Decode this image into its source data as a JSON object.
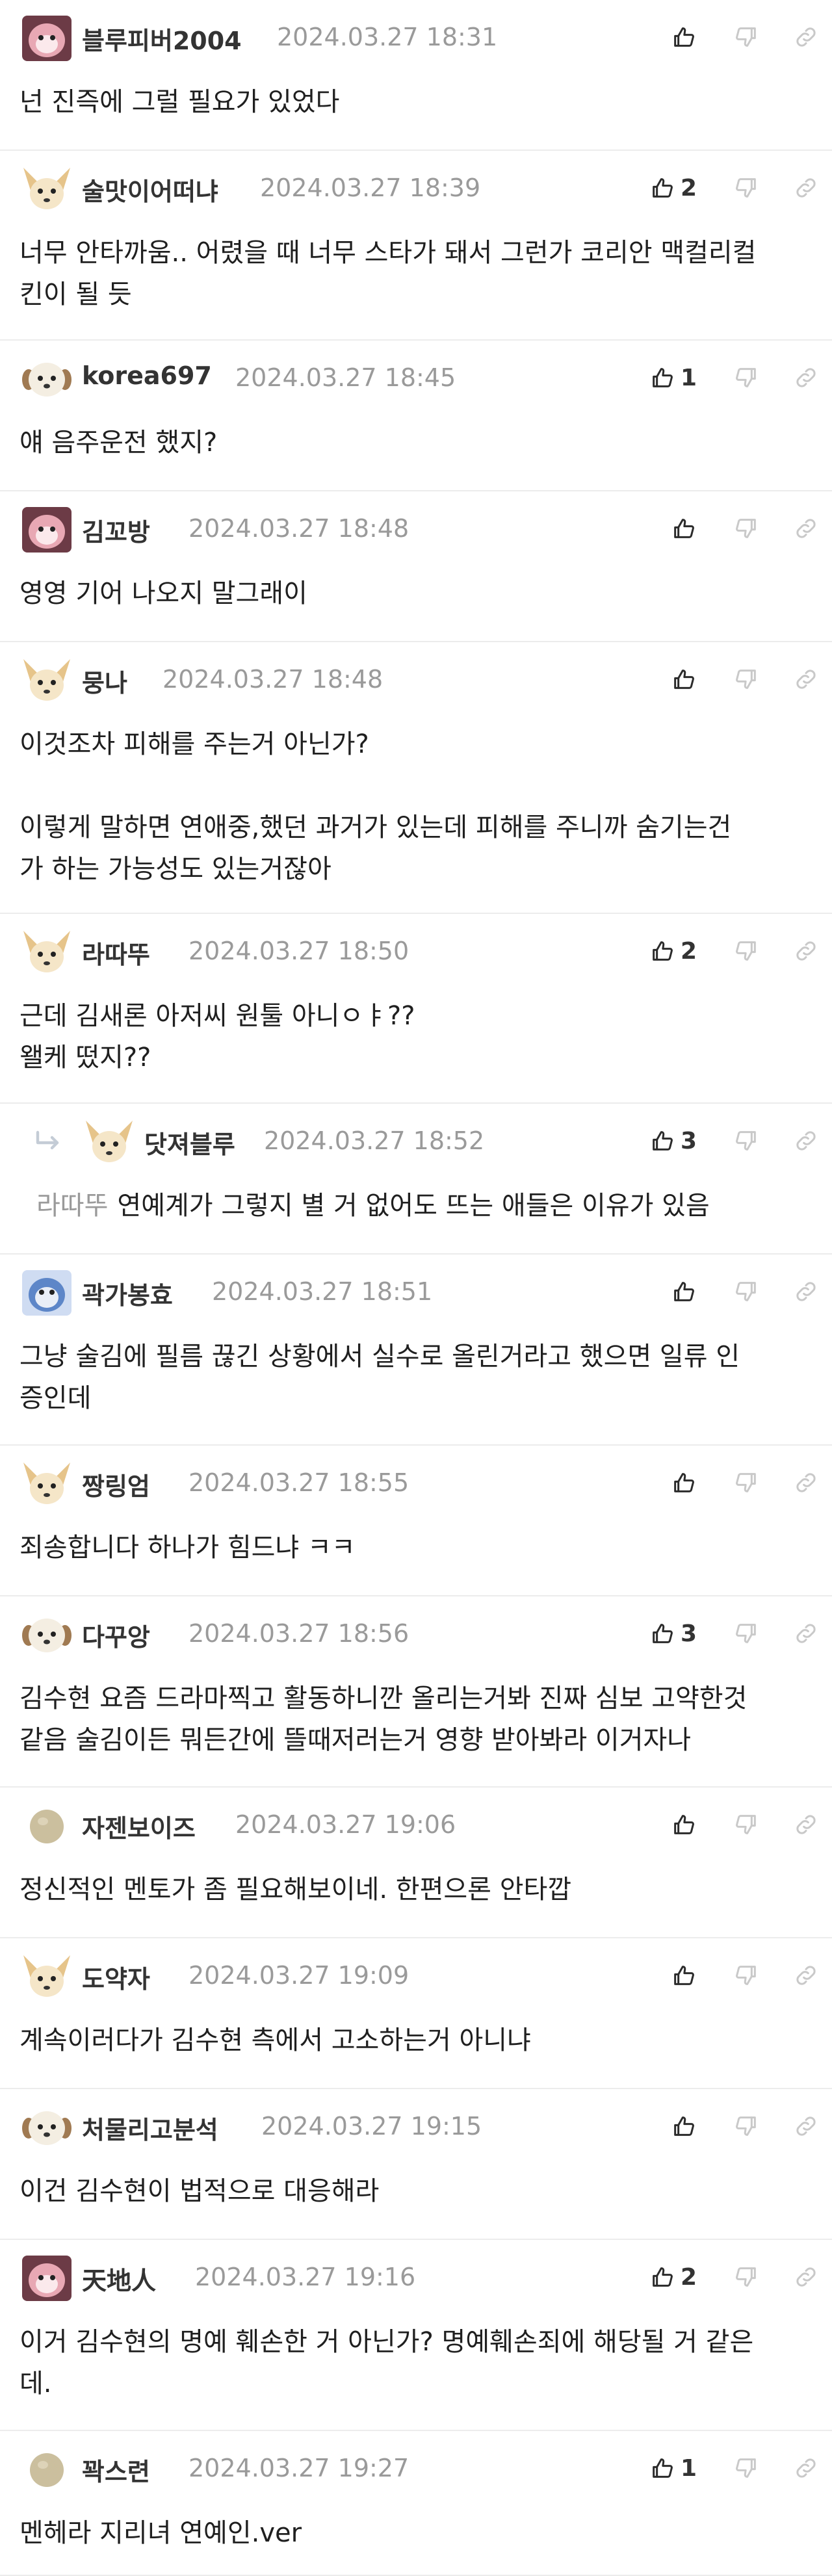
{
  "comments": [
    {
      "nick": "블루피버2004",
      "date": "2024.03.27 18:31",
      "likes": "",
      "text": "넌 진즉에 그럴 필요가 있었다",
      "avatar": "pink-monster-avatar"
    },
    {
      "nick": "술맛이어떠냐",
      "date": "2024.03.27 18:39",
      "likes": "2",
      "text": "너무 안타까움.. 어렸을 때 너무 스타가 돼서 그런가 코리안 맥컬리컬\n킨이 될 듯",
      "avatar": "chihuahua-avatar"
    },
    {
      "nick": "korea697",
      "date": "2024.03.27 18:45",
      "likes": "1",
      "text": "얘 음주운전 했지?",
      "avatar": "puppy-avatar"
    },
    {
      "nick": "김꼬방",
      "date": "2024.03.27 18:48",
      "likes": "",
      "text": "영영 기어 나오지 말그래이",
      "avatar": "pink-monster-avatar"
    },
    {
      "nick": "뭉나",
      "date": "2024.03.27 18:48",
      "likes": "",
      "text": "이것조차 피해를 주는거 아닌가?\n\n이렇게 말하면 연애중,했던 과거가 있는데 피해를 주니까 숨기는건\n가 하는 가능성도 있는거잖아",
      "avatar": "chihuahua-avatar"
    },
    {
      "nick": "라따뚜",
      "date": "2024.03.27 18:50",
      "likes": "2",
      "text": "근데 김새론 아저씨 원툴 아니ㅇㅑ??\n왤케 떴지??",
      "avatar": "chihuahua-avatar"
    },
    {
      "nick": "닷져블루",
      "date": "2024.03.27 18:52",
      "likes": "3",
      "reply_to": "라따뚜",
      "text": "연예계가 그렇지 별 거 없어도 뜨는 애들은 이유가 있음",
      "avatar": "chihuahua-avatar"
    },
    {
      "nick": "곽가봉효",
      "date": "2024.03.27 18:51",
      "likes": "",
      "text": "그냥 술김에 필름 끊긴 상황에서 실수로 올린거라고 했으면 일류 인\n증인데",
      "avatar": "blue-monster-avatar"
    },
    {
      "nick": "짱링엄",
      "date": "2024.03.27 18:55",
      "likes": "",
      "text": "죄송합니다 하나가 힘드냐 ㅋㅋ",
      "avatar": "chihuahua-avatar"
    },
    {
      "nick": "다꾸앙",
      "date": "2024.03.27 18:56",
      "likes": "3",
      "text": "김수현 요즘 드라마찍고 활동하니깐 올리는거봐 진짜 심보 고약한것\n같음 술김이든 뭐든간에 뜰때저러는거 영향 받아봐라 이거자나",
      "avatar": "puppy-avatar"
    },
    {
      "nick": "자젠보이즈",
      "date": "2024.03.27 19:06",
      "likes": "",
      "text": "정신적인 멘토가 좀 필요해보이네. 한편으론 안타깝",
      "avatar": "egg-avatar"
    },
    {
      "nick": "도약자",
      "date": "2024.03.27 19:09",
      "likes": "",
      "text": "계속이러다가 김수현 측에서 고소하는거 아니냐",
      "avatar": "chihuahua-avatar"
    },
    {
      "nick": "처물리고분석",
      "date": "2024.03.27 19:15",
      "likes": "",
      "text": "이건 김수현이 법적으로 대응해라",
      "avatar": "puppy-avatar"
    },
    {
      "nick": "天地人",
      "date": "2024.03.27 19:16",
      "likes": "2",
      "text": "이거 김수현의 명예 훼손한 거 아닌가? 명예훼손죄에 해당될 거 같은\n데.",
      "avatar": "pink-monster-avatar"
    },
    {
      "nick": "꽉스련",
      "date": "2024.03.27 19:27",
      "likes": "1",
      "text": "멘헤라 지리녀 연예인.ver",
      "avatar": "egg-avatar"
    }
  ],
  "icons": {
    "like": "thumbs-up-icon",
    "dislike": "thumbs-down-icon",
    "link": "link-icon",
    "reply": "reply-arrow-icon"
  }
}
